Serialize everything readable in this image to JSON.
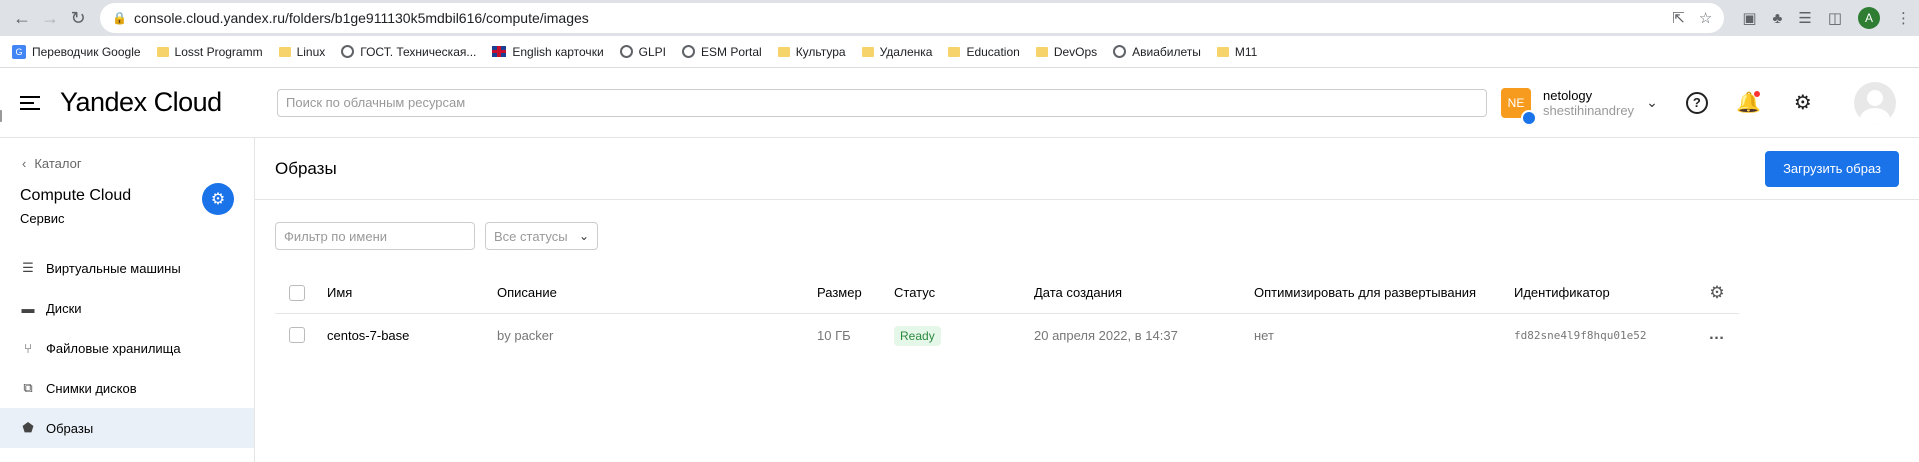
{
  "browser": {
    "url": "console.cloud.yandex.ru/folders/b1ge911130k5mdbil616/compute/images",
    "profile_initial": "A",
    "bookmarks": [
      {
        "label": "Переводчик Google",
        "icon": "google-translate-icon"
      },
      {
        "label": "Losst Programm",
        "icon": "folder-icon"
      },
      {
        "label": "Linux",
        "icon": "folder-icon"
      },
      {
        "label": "ГОСТ. Техническая...",
        "icon": "globe-icon"
      },
      {
        "label": "English карточки",
        "icon": "uk-flag-icon"
      },
      {
        "label": "GLPI",
        "icon": "globe-icon"
      },
      {
        "label": "ESM Portal",
        "icon": "globe-icon"
      },
      {
        "label": "Культура",
        "icon": "folder-icon"
      },
      {
        "label": "Удаленка",
        "icon": "folder-icon"
      },
      {
        "label": "Education",
        "icon": "folder-icon"
      },
      {
        "label": "DevOps",
        "icon": "folder-icon"
      },
      {
        "label": "Авиабилеты",
        "icon": "globe-icon"
      },
      {
        "label": "M11",
        "icon": "folder-icon"
      }
    ]
  },
  "header": {
    "logo": "Yandex Cloud",
    "search_placeholder": "Поиск по облачным ресурсам",
    "account": {
      "badge": "NE",
      "name": "netology",
      "user": "shestihinandrey"
    }
  },
  "sidebar": {
    "back_label": "Каталог",
    "service_title": "Compute Cloud",
    "service_subtitle": "Сервис",
    "items": [
      {
        "label": "Виртуальные машины",
        "icon": "vm-icon",
        "active": false
      },
      {
        "label": "Диски",
        "icon": "disk-icon",
        "active": false
      },
      {
        "label": "Файловые хранилища",
        "icon": "file-storage-icon",
        "active": false
      },
      {
        "label": "Снимки дисков",
        "icon": "snapshots-icon",
        "active": false
      },
      {
        "label": "Образы",
        "icon": "images-icon",
        "active": true
      }
    ]
  },
  "main": {
    "title": "Образы",
    "upload_button": "Загрузить образ",
    "filter_placeholder": "Фильтр по имени",
    "status_select": "Все статусы",
    "table": {
      "headers": {
        "name": "Имя",
        "description": "Описание",
        "size": "Размер",
        "status": "Статус",
        "created": "Дата создания",
        "optimize": "Оптимизировать для развертывания",
        "id": "Идентификатор"
      },
      "rows": [
        {
          "name": "centos-7-base",
          "description": "by packer",
          "size": "10 ГБ",
          "status": "Ready",
          "created": "20 апреля 2022, в 14:37",
          "optimize": "нет",
          "id": "fd82sne4l9f8hqu01e52"
        }
      ]
    }
  },
  "colors": {
    "accent": "#1a73e8",
    "ready_bg": "#e5f7e9",
    "ready_text": "#2c8a3e",
    "account_badge": "#f79b1e"
  }
}
